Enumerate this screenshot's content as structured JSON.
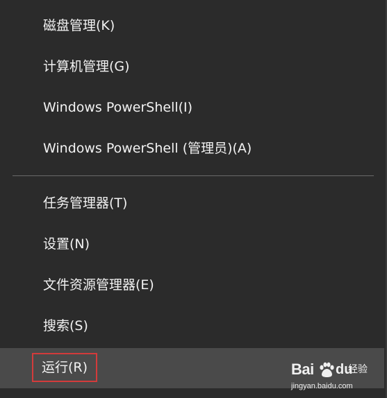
{
  "menu": {
    "items": [
      {
        "label": "磁盘管理(K)"
      },
      {
        "label": "计算机管理(G)"
      },
      {
        "label": "Windows PowerShell(I)"
      },
      {
        "label": "Windows PowerShell (管理员)(A)"
      },
      {
        "label": "任务管理器(T)"
      },
      {
        "label": "设置(N)"
      },
      {
        "label": "文件资源管理器(E)"
      },
      {
        "label": "搜索(S)"
      },
      {
        "label": "运行(R)"
      }
    ]
  },
  "watermark": {
    "brand_bai": "Bai",
    "brand_du": "du",
    "brand_cn": "经验",
    "url": "jingyan.baidu.com"
  },
  "colors": {
    "background": "#2b2b2b",
    "hover_row": "#4a4a4a",
    "highlight_outline": "#d33b3b",
    "text": "#f2f2f2"
  }
}
